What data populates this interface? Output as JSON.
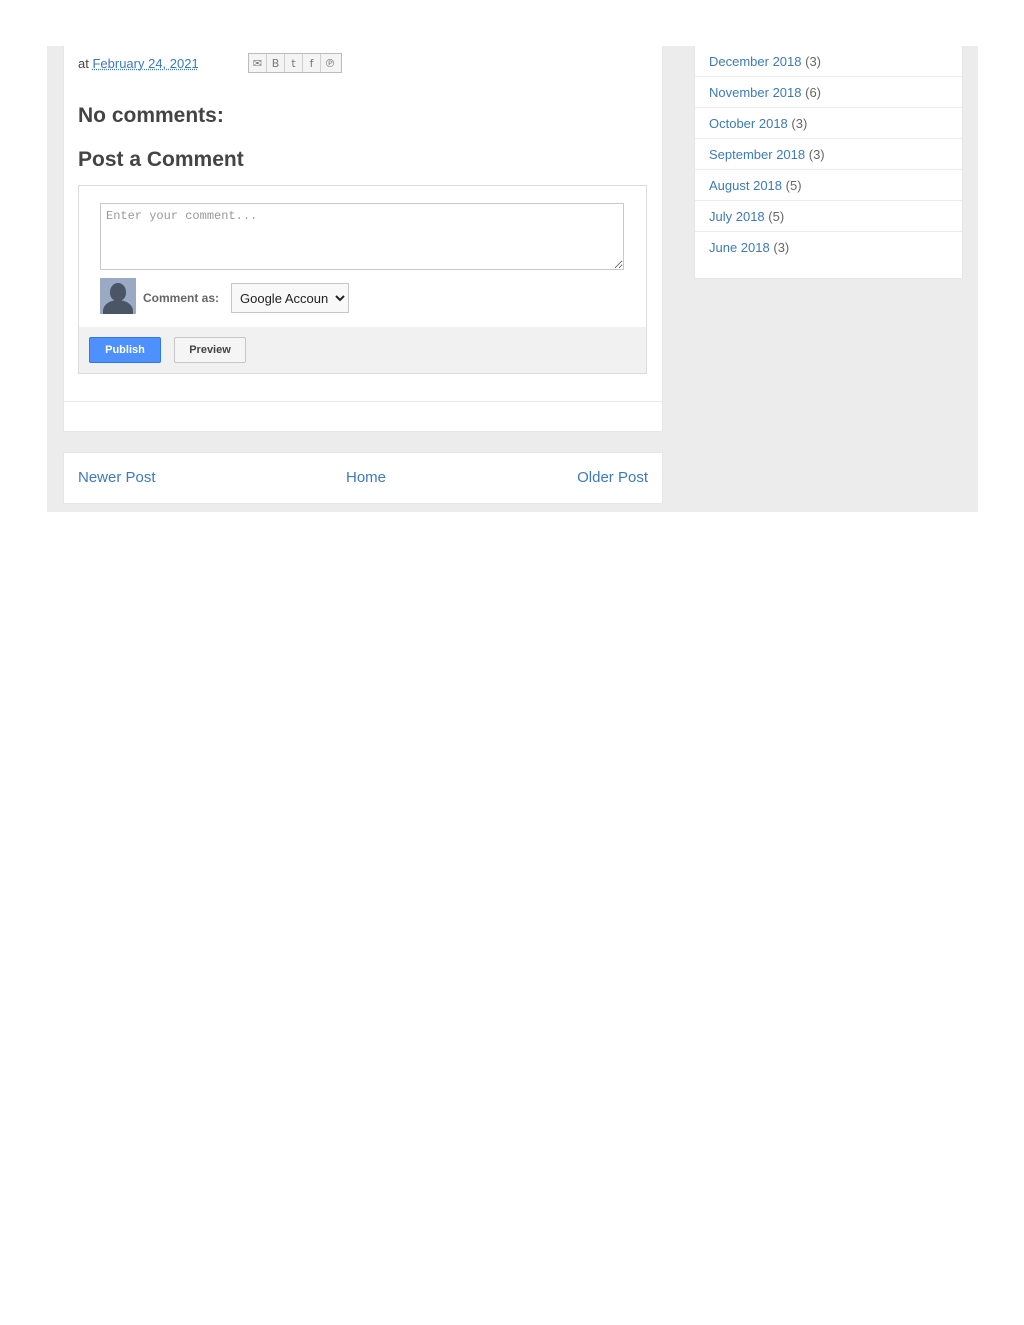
{
  "post": {
    "byline_prefix": "at",
    "date": "February 24, 2021",
    "share_icons": [
      "email-icon",
      "blogger-icon",
      "twitter-icon",
      "facebook-icon",
      "pinterest-icon"
    ]
  },
  "comments": {
    "no_comments_heading": "No comments:",
    "post_comment_heading": "Post a Comment",
    "textarea_placeholder": "Enter your comment...",
    "comment_as_label": "Comment as:",
    "identity_selected": "Google Accoun",
    "publish_label": "Publish",
    "preview_label": "Preview"
  },
  "pager": {
    "newer": "Newer Post",
    "home": "Home",
    "older": "Older Post"
  },
  "archive": [
    {
      "label": "December 2018",
      "count": "(3)"
    },
    {
      "label": "November 2018",
      "count": "(6)"
    },
    {
      "label": "October 2018",
      "count": "(3)"
    },
    {
      "label": "September 2018",
      "count": "(3)"
    },
    {
      "label": "August 2018",
      "count": "(5)"
    },
    {
      "label": "July 2018",
      "count": "(5)"
    },
    {
      "label": "June 2018",
      "count": "(3)"
    }
  ],
  "colors": {
    "link": "#3d7ab8",
    "publish_button": "#4d90fe",
    "page_background": "#ececec"
  }
}
